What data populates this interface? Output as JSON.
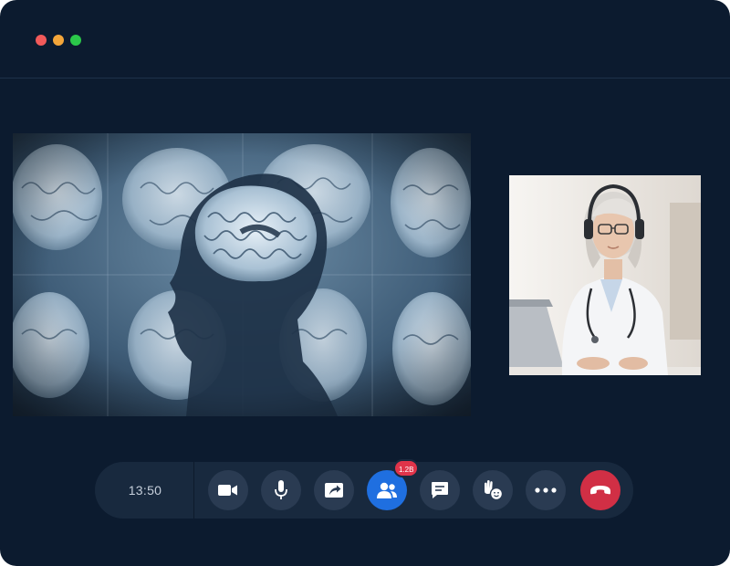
{
  "window": {
    "controls": [
      "close-dot",
      "minimize-dot",
      "maximize-dot"
    ]
  },
  "call": {
    "elapsed_time": "13:50",
    "participants_badge": "1.2B"
  },
  "controls": [
    {
      "name": "camera-button",
      "icon": "video-camera-icon"
    },
    {
      "name": "microphone-button",
      "icon": "microphone-icon"
    },
    {
      "name": "share-screen-button",
      "icon": "share-screen-icon"
    },
    {
      "name": "participants-button",
      "icon": "people-icon",
      "active": true
    },
    {
      "name": "chat-button",
      "icon": "chat-icon"
    },
    {
      "name": "reactions-button",
      "icon": "raise-hand-emoji-icon"
    },
    {
      "name": "more-options-button",
      "icon": "more-dots-icon"
    },
    {
      "name": "hang-up-button",
      "icon": "phone-hangup-icon"
    }
  ],
  "colors": {
    "background": "#0c1b2f",
    "controlbar": "#18293e",
    "button": "#2a3b52",
    "active_button": "#1f6fe0",
    "hangup": "#d12f45",
    "badge": "#e0344a"
  }
}
